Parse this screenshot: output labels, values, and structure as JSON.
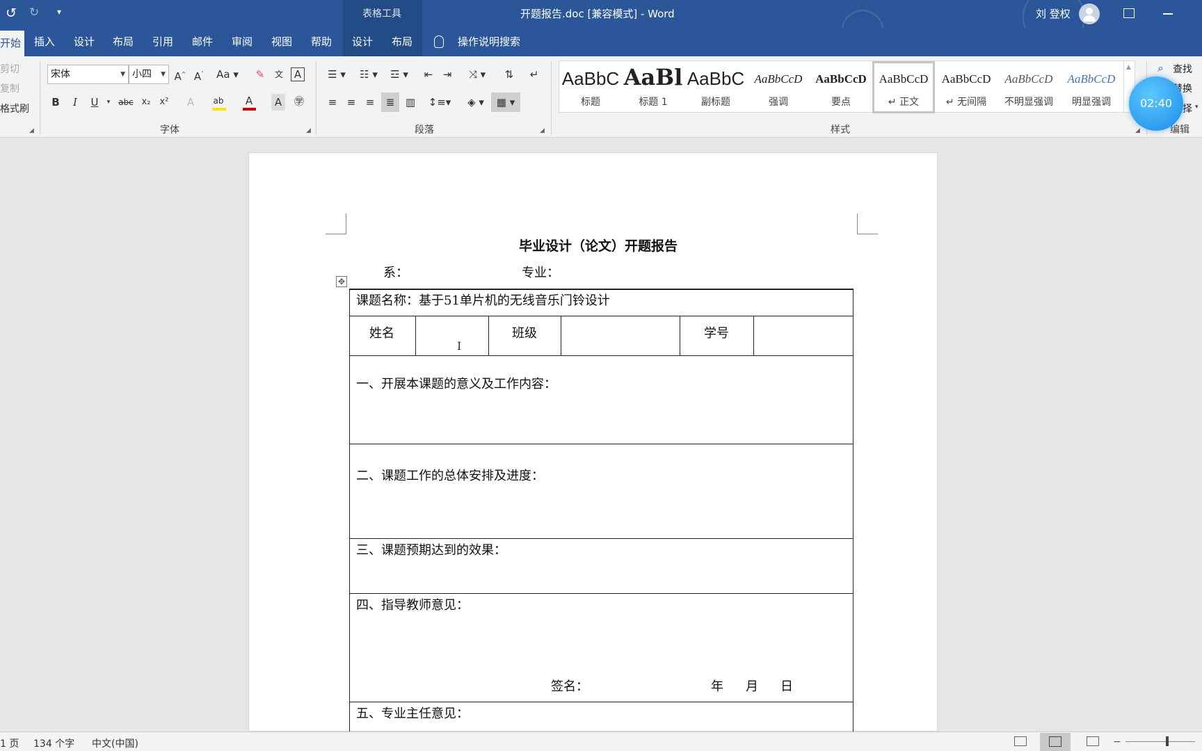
{
  "window": {
    "title": "开题报告.doc [兼容模式]  -  Word",
    "context_tab_group": "表格工具",
    "user": "刘 登权"
  },
  "tabs": [
    "开始",
    "插入",
    "设计",
    "布局",
    "引用",
    "邮件",
    "审阅",
    "视图",
    "帮助",
    "设计",
    "布局"
  ],
  "search_tell_me": "操作说明搜索",
  "clipboard": {
    "cut": "剪切",
    "copy": "复制",
    "format_painter": "格式刷"
  },
  "font": {
    "name": "宋体",
    "size": "小四",
    "group_label": "字体",
    "bold": "B",
    "italic": "I",
    "underline": "U",
    "strike": "abc",
    "subscript": "x₂",
    "superscript": "x²",
    "case": "Aa"
  },
  "paragraph": {
    "group_label": "段落"
  },
  "styles": {
    "group_label": "样式",
    "items": [
      {
        "preview": "AaBbC",
        "name": "标题"
      },
      {
        "preview": "AaBl",
        "name": "标题 1"
      },
      {
        "preview": "AaBbC",
        "name": "副标题"
      },
      {
        "preview": "AaBbCcD",
        "name": "强调"
      },
      {
        "preview": "AaBbCcD",
        "name": "要点"
      },
      {
        "preview": "AaBbCcD",
        "name": "↵ 正文"
      },
      {
        "preview": "AaBbCcD",
        "name": "↵ 无间隔"
      },
      {
        "preview": "AaBbCcD",
        "name": "不明显强调"
      },
      {
        "preview": "AaBbCcD",
        "name": "明显强调"
      }
    ]
  },
  "editing": {
    "find": "查找",
    "replace": "替换",
    "select": "选择",
    "group_label": "编辑"
  },
  "timer": "02:40",
  "document": {
    "title": "毕业设计（论文）开题报告",
    "dept_label": "系：",
    "major_label": "专业：",
    "topic": "课题名称：基于51单片机的无线音乐门铃设计",
    "name_label": "姓名",
    "class_label": "班级",
    "id_label": "学号",
    "section1": "一、开展本课题的意义及工作内容：",
    "section2": "二、课题工作的总体安排及进度：",
    "section3": "三、课题预期达到的效果：",
    "section4": "四、指导教师意见：",
    "sign_label": "签名：",
    "year": "年",
    "month": "月",
    "day": "日",
    "section5": "五、专业主任意见："
  },
  "status": {
    "page": "1 页",
    "words": "134 个字",
    "language": "中文(中国)"
  },
  "colors": {
    "accent": "#2b579a",
    "timer": "#1b8ae6"
  }
}
